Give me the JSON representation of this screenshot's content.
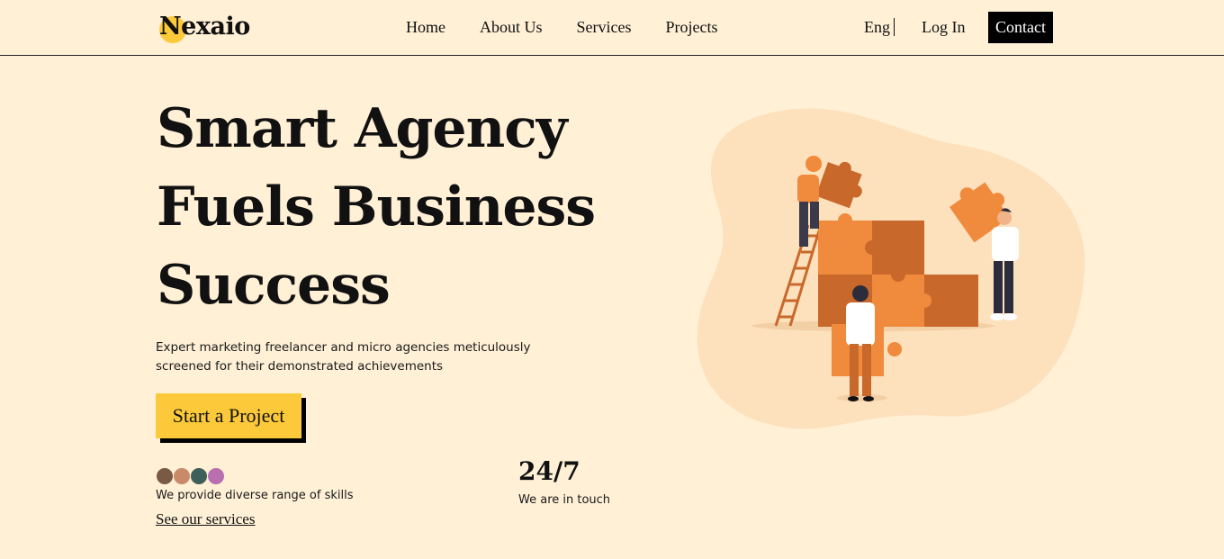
{
  "header": {
    "logo": "Nexaio",
    "nav": [
      "Home",
      "About Us",
      "Services",
      "Projects"
    ],
    "lang": "Eng",
    "login": "Log In",
    "contact": "Contact"
  },
  "hero": {
    "title_lines": [
      "Smart Agency",
      "Fuels Business",
      "Success"
    ],
    "subtitle": "Expert marketing freelancer and micro agencies meticulously screened for their demonstrated achievements",
    "cta": "Start a Project"
  },
  "skills": {
    "text": "We provide diverse range of skills",
    "link": "See our services"
  },
  "stat": {
    "value": "24/7",
    "label": "We are in touch"
  },
  "colors": {
    "background": "#fff0d6",
    "accent": "#fcc93a",
    "puzzle_light": "#f08a3c",
    "puzzle_dark": "#c8692b"
  }
}
